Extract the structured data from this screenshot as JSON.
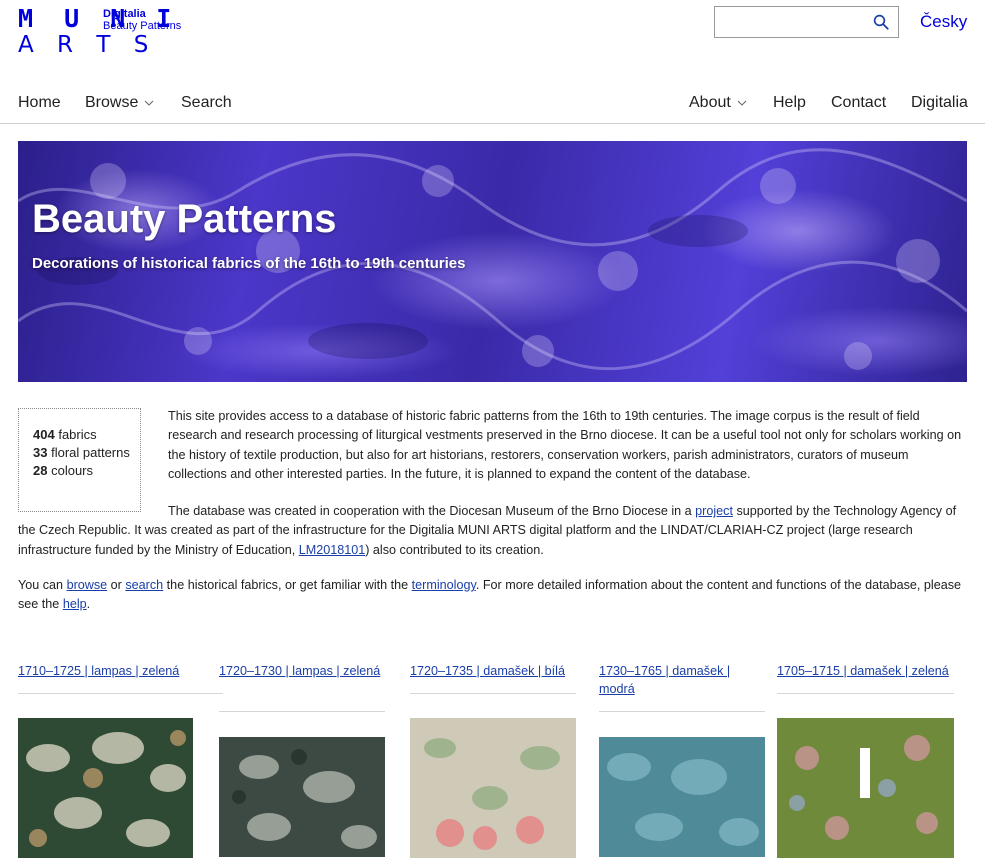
{
  "header": {
    "logo_muni": "M U N I",
    "logo_arts": "A R T S",
    "logo_sub1": "Digitalia",
    "logo_sub2": "Beauty Patterns",
    "search_value": "",
    "search_icon": "search-icon",
    "lang": "Česky"
  },
  "nav": {
    "home": "Home",
    "browse": "Browse",
    "search": "Search",
    "about": "About",
    "help": "Help",
    "contact": "Contact",
    "digitalia": "Digitalia"
  },
  "hero": {
    "title": "Beauty Patterns",
    "subtitle": "Decorations of historical fabrics of the 16th to 19th centuries"
  },
  "stats": {
    "fabrics_count": "404",
    "fabrics_label": "fabrics",
    "patterns_count": "33",
    "patterns_label": "floral patterns",
    "colours_count": "28",
    "colours_label": "colours"
  },
  "intro": {
    "p1": "This site provides access to a database of historic fabric patterns from the 16th to 19th centuries. The image corpus is the result of field research and research processing of liturgical vestments preserved in the Brno diocese. It can be a useful tool not only for scholars working on the history of textile production, but also for art historians, restorers, conservation workers, parish administrators, curators of museum collections and other interested parties. In the future, it is planned to expand the content of the database.",
    "p2_a": "The database was created in cooperation with the Diocesan Museum of the Brno Diocese in a ",
    "p2_link": "project",
    "p2_b": " supported by the Technology Agency of the Czech Republic. It was created as part of the infrastructure for the Digitalia MUNI ARTS digital platform and the LINDAT/CLARIAH-CZ project (large research infrastructure funded by the Ministry of Education, ",
    "p2_link2": "LM2018101",
    "p2_c": ") also contributed to its creation.",
    "p3_a": "You can ",
    "p3_browse": "browse",
    "p3_b": " or ",
    "p3_search": "search",
    "p3_c": " the historical fabrics, or get familiar with the ",
    "p3_terminology": "terminology",
    "p3_d": ". For more detailed information about the content and functions of the database, please see the ",
    "p3_help": "help",
    "p3_e": "."
  },
  "items": [
    {
      "title": "1710–1725 | lampas | zelená",
      "color": "#2f4a34"
    },
    {
      "title": "1720–1730 | lampas | zelená",
      "color": "#3d4a43"
    },
    {
      "title": "1720–1735 | damašek | bílá",
      "color": "#cfc9b8"
    },
    {
      "title": "1730–1765 | damašek | modrá",
      "color": "#4f8a99"
    },
    {
      "title": "1705–1715 | damašek | zelená",
      "color": "#6f8a3a"
    }
  ]
}
